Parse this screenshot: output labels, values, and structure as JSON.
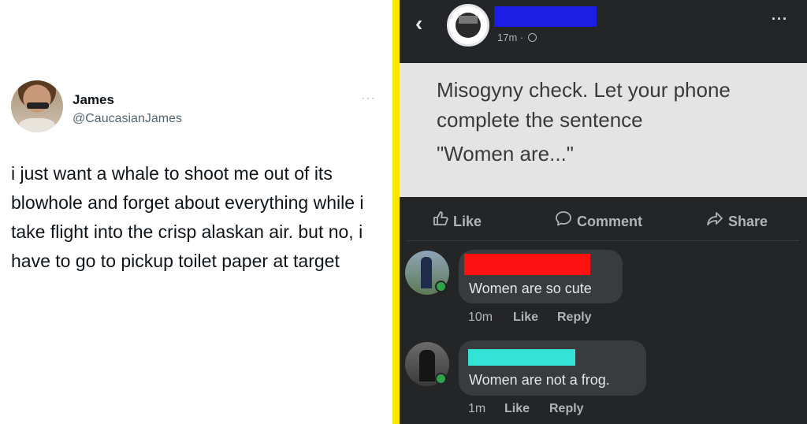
{
  "tweet": {
    "name": "James",
    "handle": "@CaucasianJames",
    "more": "···",
    "text": "i just want a whale to shoot me out of its blowhole and forget about everything while i take flight into the crisp alaskan air. but no, i have to go to pickup toilet paper at target"
  },
  "divider_color": "#ffe600",
  "fb": {
    "back": "‹",
    "time": "17m ·",
    "more": "···",
    "post": {
      "line1": "Misogyny check. Let your phone complete the sentence",
      "line2": "\"Women are...\""
    },
    "actions": {
      "like": "Like",
      "comment": "Comment",
      "share": "Share"
    },
    "comments": [
      {
        "redaction_color": "#ff1010",
        "text": "Women are so cute",
        "time": "10m",
        "like": "Like",
        "reply": "Reply"
      },
      {
        "redaction_color": "#33e4d6",
        "text": "Women are not a frog.",
        "time": "1m",
        "like": "Like",
        "reply": "Reply"
      }
    ]
  }
}
